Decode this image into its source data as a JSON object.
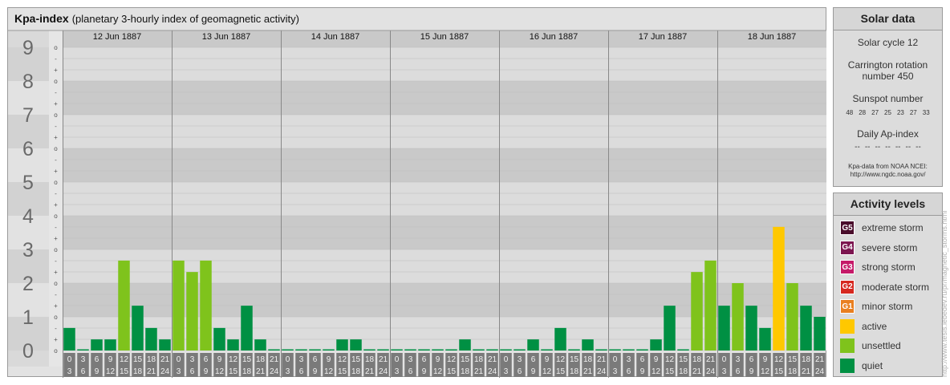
{
  "title": "Kpa-index",
  "subtitle": "(planetary 3-hourly index of geomagnetic activity)",
  "colors": {
    "quiet": "#009043",
    "unsettled": "#7fc31c",
    "active": "#ffc800",
    "minor": "#e97f20",
    "moderate": "#d6281f",
    "strong": "#c51a69",
    "severe": "#7c1650",
    "extreme": "#4a0d2b"
  },
  "chart_data": {
    "type": "bar",
    "ylim": [
      0,
      9
    ],
    "y_ticks": [
      "0",
      "1",
      "2",
      "3",
      "4",
      "5",
      "6",
      "7",
      "8",
      "9"
    ],
    "sub_ticks": [
      "o",
      "+",
      "-",
      "o",
      "+",
      "-",
      "o",
      "+",
      "-",
      "o",
      "+",
      "-",
      "o",
      "+",
      "-",
      "o",
      "+",
      "-",
      "o",
      "+",
      "-",
      "o",
      "+",
      "-",
      "o",
      "+",
      "-",
      "o"
    ],
    "days": [
      {
        "label": "12 Jun 1887",
        "values": [
          0.67,
          0.0,
          0.33,
          0.33,
          2.67,
          1.33,
          0.67,
          0.33
        ]
      },
      {
        "label": "13 Jun 1887",
        "values": [
          2.67,
          2.33,
          2.67,
          0.67,
          0.33,
          1.33,
          0.33,
          0.0
        ]
      },
      {
        "label": "14 Jun 1887",
        "values": [
          0.0,
          0.0,
          0.0,
          0.0,
          0.33,
          0.33,
          0.0,
          0.0
        ]
      },
      {
        "label": "15 Jun 1887",
        "values": [
          0.0,
          0.0,
          0.0,
          0.0,
          0.0,
          0.33,
          0.0,
          0.0
        ]
      },
      {
        "label": "16 Jun 1887",
        "values": [
          0.0,
          0.0,
          0.33,
          0.0,
          0.67,
          0.0,
          0.33,
          0.0
        ]
      },
      {
        "label": "17 Jun 1887",
        "values": [
          0.0,
          0.0,
          0.0,
          0.33,
          1.33,
          0.0,
          2.33,
          2.67
        ]
      },
      {
        "label": "18 Jun 1887",
        "values": [
          1.33,
          2.0,
          1.33,
          0.67,
          3.67,
          2.0,
          1.33,
          1.0
        ]
      }
    ],
    "slot_labels": [
      [
        "0",
        "3"
      ],
      [
        "3",
        "6"
      ],
      [
        "6",
        "9"
      ],
      [
        "9",
        "12"
      ],
      [
        "12",
        "15"
      ],
      [
        "15",
        "18"
      ],
      [
        "18",
        "21"
      ],
      [
        "21",
        "24"
      ]
    ],
    "thresholds": {
      "unsettled": 2,
      "active": 3.67,
      "minor": 4.67
    }
  },
  "solar_data": {
    "title": "Solar data",
    "solar_cycle": "Solar cycle 12",
    "carrington_line1": "Carrington rotation",
    "carrington_line2": "number 450",
    "sunspot_title": "Sunspot number",
    "sunspots": [
      "48",
      "28",
      "27",
      "25",
      "23",
      "27",
      "33"
    ],
    "ap_title": "Daily Ap-index",
    "ap_values": [
      "--",
      "--",
      "--",
      "--",
      "--",
      "--",
      "--"
    ],
    "source_line1": "Kpa-data from NOAA NCEI:",
    "source_line2": "http://www.ngdc.noaa.gov/"
  },
  "activity_levels": {
    "title": "Activity levels",
    "items": [
      {
        "code": "G5",
        "label": "extreme storm",
        "color": "#4a0d2b"
      },
      {
        "code": "G4",
        "label": "severe storm",
        "color": "#7c1650"
      },
      {
        "code": "G3",
        "label": "strong storm",
        "color": "#c51a69"
      },
      {
        "code": "G2",
        "label": "moderate storm",
        "color": "#d6281f"
      },
      {
        "code": "G1",
        "label": "minor storm",
        "color": "#e97f20"
      },
      {
        "code": "",
        "label": "active",
        "color": "#ffc800"
      },
      {
        "code": "",
        "label": "unsettled",
        "color": "#7fc31c"
      },
      {
        "code": "",
        "label": "quiet",
        "color": "#009043"
      }
    ]
  },
  "credit": "http://www.tesis.lebedev.ru/pr/magnetic_storms.html"
}
